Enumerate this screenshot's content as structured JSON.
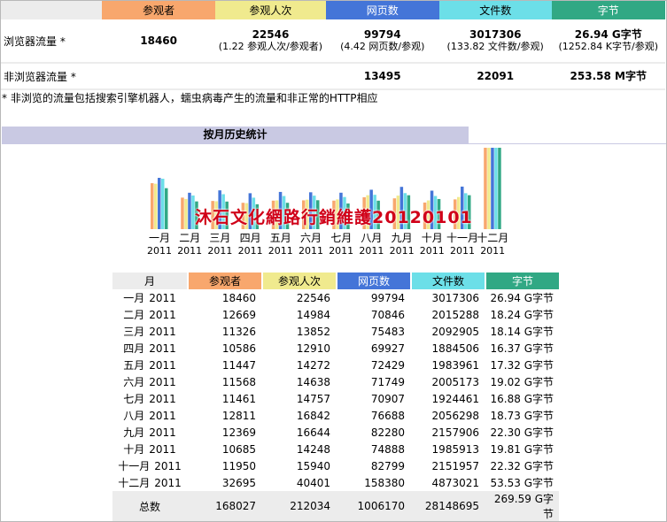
{
  "colors": {
    "visitors": "#f8a76d",
    "visits": "#f0ea8e",
    "pages": "#4475d8",
    "files": "#6cdfe8",
    "bytes": "#31a884",
    "section": "#c9c9e3"
  },
  "summary": {
    "headers": [
      "参观者",
      "参观人次",
      "网页数",
      "文件数",
      "字节"
    ],
    "browser_label": "浏览器流量 *",
    "browser": {
      "visitors": "18460",
      "visits": "22546",
      "visits_sub": "(1.22 参观人次/参观者)",
      "pages": "99794",
      "pages_sub": "(4.42 网页数/参观)",
      "files": "3017306",
      "files_sub": "(133.82 文件数/参观)",
      "bytes": "26.94 G字节",
      "bytes_sub": "(1252.84 K字节/参观)"
    },
    "nonbrowser_label": "非浏览器流量 *",
    "nonbrowser": {
      "pages": "13495",
      "files": "22091",
      "bytes": "253.58 M字节"
    },
    "note": "* 非浏览的流量包括搜索引擎机器人，蠕虫病毒产生的流量和非正常的HTTP相应"
  },
  "section_title": "按月历史统计",
  "watermark": "沐石文化網路行銷維護20120101",
  "monthly": {
    "headers": [
      "月",
      "参观者",
      "参观人次",
      "网页数",
      "文件数",
      "字节"
    ],
    "rows": [
      {
        "month": "一月",
        "year": "2011",
        "visitors": "18460",
        "visits": "22546",
        "pages": "99794",
        "files": "3017306",
        "bytes": "26.94 G字节"
      },
      {
        "month": "二月",
        "year": "2011",
        "visitors": "12669",
        "visits": "14984",
        "pages": "70846",
        "files": "2015288",
        "bytes": "18.24 G字节"
      },
      {
        "month": "三月",
        "year": "2011",
        "visitors": "11326",
        "visits": "13852",
        "pages": "75483",
        "files": "2092905",
        "bytes": "18.14 G字节"
      },
      {
        "month": "四月",
        "year": "2011",
        "visitors": "10586",
        "visits": "12910",
        "pages": "69927",
        "files": "1884506",
        "bytes": "16.37 G字节"
      },
      {
        "month": "五月",
        "year": "2011",
        "visitors": "11447",
        "visits": "14272",
        "pages": "72429",
        "files": "1983961",
        "bytes": "17.32 G字节"
      },
      {
        "month": "六月",
        "year": "2011",
        "visitors": "11568",
        "visits": "14638",
        "pages": "71749",
        "files": "2005173",
        "bytes": "19.02 G字节"
      },
      {
        "month": "七月",
        "year": "2011",
        "visitors": "11461",
        "visits": "14757",
        "pages": "70907",
        "files": "1924461",
        "bytes": "16.88 G字节"
      },
      {
        "month": "八月",
        "year": "2011",
        "visitors": "12811",
        "visits": "16842",
        "pages": "76688",
        "files": "2056298",
        "bytes": "18.73 G字节"
      },
      {
        "month": "九月",
        "year": "2011",
        "visitors": "12369",
        "visits": "16644",
        "pages": "82280",
        "files": "2157906",
        "bytes": "22.30 G字节"
      },
      {
        "month": "十月",
        "year": "2011",
        "visitors": "10685",
        "visits": "14248",
        "pages": "74888",
        "files": "1985913",
        "bytes": "19.81 G字节"
      },
      {
        "month": "十一月",
        "year": "2011",
        "visitors": "11950",
        "visits": "15940",
        "pages": "82799",
        "files": "2151957",
        "bytes": "22.32 G字节"
      },
      {
        "month": "十二月",
        "year": "2011",
        "visitors": "32695",
        "visits": "40401",
        "pages": "158380",
        "files": "4873021",
        "bytes": "53.53 G字节"
      }
    ],
    "total": {
      "label": "总数",
      "visitors": "168027",
      "visits": "212034",
      "pages": "1006170",
      "files": "28148695",
      "bytes": "269.59 G字节"
    }
  },
  "chart_data": {
    "type": "bar",
    "categories": [
      "一月 2011",
      "二月 2011",
      "三月 2011",
      "四月 2011",
      "五月 2011",
      "六月 2011",
      "七月 2011",
      "八月 2011",
      "九月 2011",
      "十月 2011",
      "十一月 2011",
      "十二月 2011"
    ],
    "category_month": [
      "一月",
      "二月",
      "三月",
      "四月",
      "五月",
      "六月",
      "七月",
      "八月",
      "九月",
      "十月",
      "十一月",
      "十二月"
    ],
    "category_year": [
      "2011",
      "2011",
      "2011",
      "2011",
      "2011",
      "2011",
      "2011",
      "2011",
      "2011",
      "2011",
      "2011",
      "2011"
    ],
    "series": [
      {
        "name": "参观者",
        "values": [
          18460,
          12669,
          11326,
          10586,
          11447,
          11568,
          11461,
          12811,
          12369,
          10685,
          11950,
          32695
        ]
      },
      {
        "name": "参观人次",
        "values": [
          22546,
          14984,
          13852,
          12910,
          14272,
          14638,
          14757,
          16842,
          16644,
          14248,
          15940,
          40401
        ]
      },
      {
        "name": "网页数",
        "values": [
          99794,
          70846,
          75483,
          69927,
          72429,
          71749,
          70907,
          76688,
          82280,
          74888,
          82799,
          158380
        ]
      },
      {
        "name": "文件数",
        "values": [
          3017306,
          2015288,
          2092905,
          1884506,
          1983961,
          2005173,
          1924461,
          2056298,
          2157906,
          1985913,
          2151957,
          4873021
        ]
      },
      {
        "name": "字节",
        "values": [
          26.94,
          18.24,
          18.14,
          16.37,
          17.32,
          19.02,
          16.88,
          18.73,
          22.3,
          19.81,
          22.32,
          53.53
        ]
      }
    ]
  }
}
